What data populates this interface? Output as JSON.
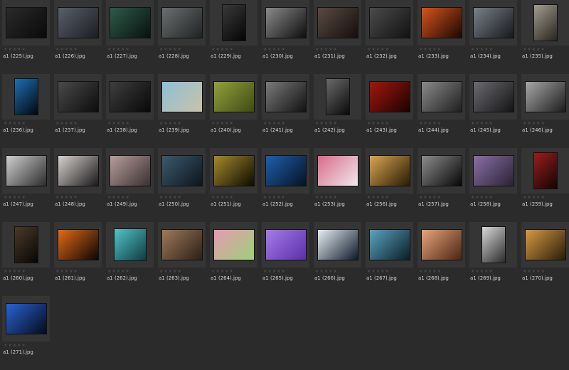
{
  "window": {
    "title": ""
  },
  "thumbnails": [
    {
      "filename": "a1 (225).jpg",
      "rating": "★★★★★",
      "orientation": "land",
      "colors": [
        "#2a2a2a",
        "#0a0a0a"
      ]
    },
    {
      "filename": "a1 (226).jpg",
      "rating": "★★★★★",
      "orientation": "land",
      "colors": [
        "#5a5f6a",
        "#1b1d22"
      ]
    },
    {
      "filename": "a1 (227).jpg",
      "rating": "★★★★★",
      "orientation": "land",
      "colors": [
        "#2f5b4b",
        "#07110d"
      ]
    },
    {
      "filename": "a1 (228).jpg",
      "rating": "★★★★★",
      "orientation": "land",
      "colors": [
        "#6a6f70",
        "#202324"
      ]
    },
    {
      "filename": "a1 (229).jpg",
      "rating": "★★★★★",
      "orientation": "port",
      "colors": [
        "#3a3a3a",
        "#040404"
      ]
    },
    {
      "filename": "a1 (230).jpg",
      "rating": "★★★★★",
      "orientation": "land",
      "colors": [
        "#8b8b8b",
        "#0d0d0d"
      ]
    },
    {
      "filename": "a1 (231).jpg",
      "rating": "★★★★★",
      "orientation": "land",
      "colors": [
        "#5a4a42",
        "#140f0d"
      ]
    },
    {
      "filename": "a1 (232).jpg",
      "rating": "★★★★★",
      "orientation": "land",
      "colors": [
        "#4b4b4b",
        "#121212"
      ]
    },
    {
      "filename": "a1 (233).jpg",
      "rating": "★★★★★",
      "orientation": "land",
      "colors": [
        "#d6541b",
        "#1a0703"
      ]
    },
    {
      "filename": "a1 (234).jpg",
      "rating": "★★★★★",
      "orientation": "land",
      "colors": [
        "#7b8189",
        "#15181b"
      ]
    },
    {
      "filename": "a1 (235).jpg",
      "rating": "★★★★★",
      "orientation": "port",
      "colors": [
        "#a39d90",
        "#27241f"
      ]
    },
    {
      "filename": "a1 (236).jpg",
      "rating": "★★★★★",
      "orientation": "port",
      "colors": [
        "#1d6fb4",
        "#02070d"
      ]
    },
    {
      "filename": "a1 (237).jpg",
      "rating": "★★★★★",
      "orientation": "land",
      "colors": [
        "#4a4a4a",
        "#0c0c0c"
      ]
    },
    {
      "filename": "a1 (238).jpg",
      "rating": "★★★★★",
      "orientation": "land",
      "colors": [
        "#3e3e3e",
        "#080808"
      ]
    },
    {
      "filename": "a1 (239).jpg",
      "rating": "★★★★★",
      "orientation": "land",
      "colors": [
        "#8fbfd8",
        "#c9c2a8"
      ]
    },
    {
      "filename": "a1 (240).jpg",
      "rating": "★★★★★",
      "orientation": "land",
      "colors": [
        "#93a13c",
        "#3f4a14"
      ]
    },
    {
      "filename": "a1 (241).jpg",
      "rating": "★★★★★",
      "orientation": "land",
      "colors": [
        "#7a7a7a",
        "#121212"
      ]
    },
    {
      "filename": "a1 (242).jpg",
      "rating": "★★★★★",
      "orientation": "port",
      "colors": [
        "#6a6a6a",
        "#090909"
      ]
    },
    {
      "filename": "a1 (243).jpg",
      "rating": "★★★★★",
      "orientation": "land",
      "colors": [
        "#a3170e",
        "#1c0201"
      ]
    },
    {
      "filename": "a1 (244).jpg",
      "rating": "★★★★★",
      "orientation": "land",
      "colors": [
        "#8a8a8a",
        "#1f1f1f"
      ]
    },
    {
      "filename": "a1 (245).jpg",
      "rating": "★★★★★",
      "orientation": "land",
      "colors": [
        "#6b6b70",
        "#141416"
      ]
    },
    {
      "filename": "a1 (246).jpg",
      "rating": "★★★★★",
      "orientation": "land",
      "colors": [
        "#a8a8a8",
        "#1c1c1c"
      ]
    },
    {
      "filename": "a1 (247).jpg",
      "rating": "★★★★★",
      "orientation": "land",
      "colors": [
        "#cfcfcf",
        "#2c2c2c"
      ]
    },
    {
      "filename": "a1 (248).jpg",
      "rating": "★★★★★",
      "orientation": "land",
      "colors": [
        "#d8d2cf",
        "#1a1a1a"
      ]
    },
    {
      "filename": "a1 (249).jpg",
      "rating": "★★★★★",
      "orientation": "land",
      "colors": [
        "#b79e9c",
        "#3a3031"
      ]
    },
    {
      "filename": "a1 (250).jpg",
      "rating": "★★★★★",
      "orientation": "land",
      "colors": [
        "#3c5a6e",
        "#0d151c"
      ]
    },
    {
      "filename": "a1 (251).jpg",
      "rating": "★★★★★",
      "orientation": "land",
      "colors": [
        "#a68a2a",
        "#0c0a02"
      ]
    },
    {
      "filename": "a1 (252).jpg",
      "rating": "★★★★★",
      "orientation": "land",
      "colors": [
        "#1f5fae",
        "#061223"
      ]
    },
    {
      "filename": "a1 (253).jpg",
      "rating": "★★★★★",
      "orientation": "land",
      "colors": [
        "#d86a8a",
        "#f1e9ec"
      ]
    },
    {
      "filename": "a1 (256).jpg",
      "rating": "★★★★★",
      "orientation": "land",
      "colors": [
        "#d9a650",
        "#2a1a05"
      ]
    },
    {
      "filename": "a1 (257).jpg",
      "rating": "★★★★★",
      "orientation": "land",
      "colors": [
        "#8d8d8d",
        "#060606"
      ]
    },
    {
      "filename": "a1 (258).jpg",
      "rating": "★★★★★",
      "orientation": "land",
      "colors": [
        "#8a6fa8",
        "#2a2234"
      ]
    },
    {
      "filename": "a1 (259).jpg",
      "rating": "★★★★★",
      "orientation": "port",
      "colors": [
        "#9b1d1d",
        "#130404"
      ]
    },
    {
      "filename": "a1 (260).jpg",
      "rating": "★★★★★",
      "orientation": "port",
      "colors": [
        "#4a3a28",
        "#070604"
      ]
    },
    {
      "filename": "a1 (261).jpg",
      "rating": "★★★★★",
      "orientation": "land",
      "colors": [
        "#e36a15",
        "#0a0503"
      ]
    },
    {
      "filename": "a1 (262).jpg",
      "rating": "★★★★★",
      "orientation": "sq",
      "colors": [
        "#53c4c8",
        "#0e3b3f"
      ]
    },
    {
      "filename": "a1 (263).jpg",
      "rating": "★★★★★",
      "orientation": "land",
      "colors": [
        "#a07a5a",
        "#2a1f17"
      ]
    },
    {
      "filename": "a1 (264).jpg",
      "rating": "★★★★★",
      "orientation": "land",
      "colors": [
        "#e59ab0",
        "#9ed07a"
      ]
    },
    {
      "filename": "a1 (265).jpg",
      "rating": "★★★★★",
      "orientation": "land",
      "colors": [
        "#a77be8",
        "#5b2fa8"
      ]
    },
    {
      "filename": "a1 (266).jpg",
      "rating": "★★★★★",
      "orientation": "land",
      "colors": [
        "#e8eef3",
        "#0d1a2a"
      ]
    },
    {
      "filename": "a1 (267).jpg",
      "rating": "★★★★★",
      "orientation": "land",
      "colors": [
        "#5aa4c0",
        "#0b1d26"
      ]
    },
    {
      "filename": "a1 (268).jpg",
      "rating": "★★★★★",
      "orientation": "land",
      "colors": [
        "#e9a47a",
        "#4a2414"
      ]
    },
    {
      "filename": "a1 (269).jpg",
      "rating": "★★★★★",
      "orientation": "port",
      "colors": [
        "#d9d9d9",
        "#2a2a2a"
      ]
    },
    {
      "filename": "a1 (270).jpg",
      "rating": "★★★★★",
      "orientation": "land",
      "colors": [
        "#d79a42",
        "#2a1b08"
      ]
    },
    {
      "filename": "a1 (271).jpg",
      "rating": "★★★★★",
      "orientation": "land",
      "colors": [
        "#2b63d3",
        "#040a1a"
      ]
    }
  ]
}
